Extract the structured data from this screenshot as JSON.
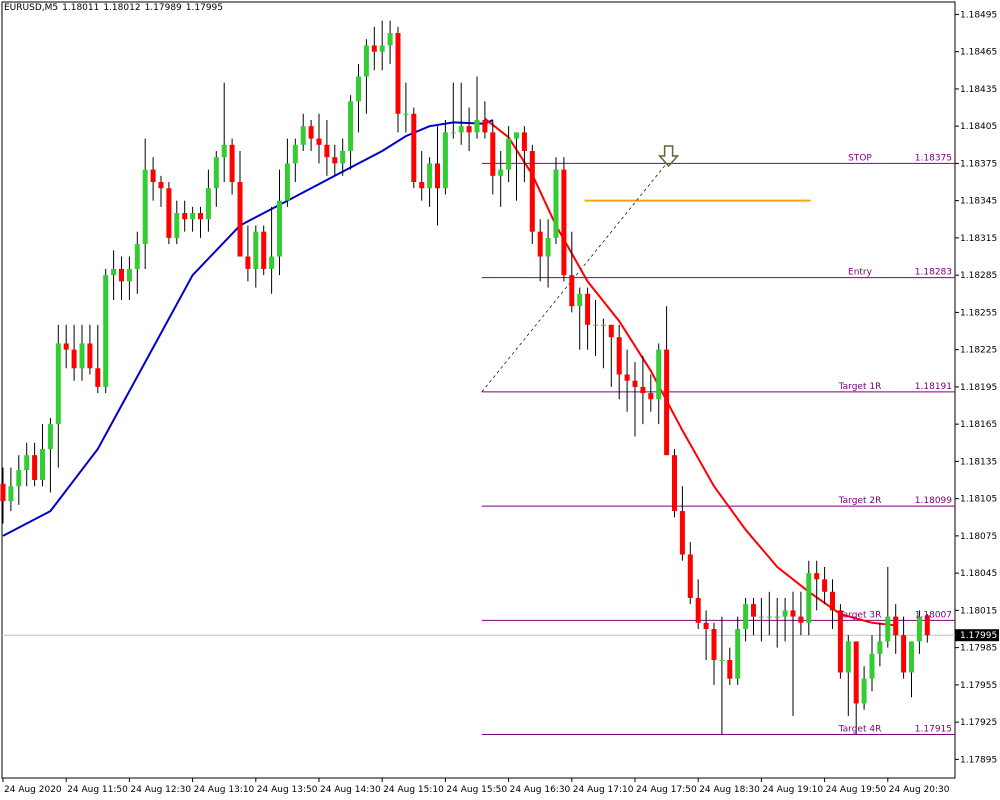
{
  "header": {
    "symbol": "EURUSD,M5",
    "ohlc": [
      "1.18011",
      "1.18012",
      "1.17989",
      "1.17995"
    ]
  },
  "colors": {
    "bull": "#32cd32",
    "bear": "#ff0000",
    "wick": "#000000",
    "ma_fast": "#0000cd",
    "ma_slow": "#ff0000",
    "level_line": "#800080",
    "level_text": "#800080",
    "zone_line": "#ffa500",
    "current_price_line": "#c0c0c0"
  },
  "chart_data": {
    "type": "candlestick",
    "symbol": "EURUSD",
    "timeframe": "M5",
    "ylim": [
      1.1788,
      1.18505
    ],
    "y_ticks": [
      "1.18495",
      "1.18465",
      "1.18435",
      "1.18405",
      "1.18375",
      "1.18345",
      "1.18315",
      "1.18285",
      "1.18255",
      "1.18225",
      "1.18195",
      "1.18165",
      "1.18135",
      "1.18105",
      "1.18075",
      "1.18045",
      "1.18015",
      "1.17985",
      "1.17955",
      "1.17925",
      "1.17895"
    ],
    "x_labels": [
      {
        "i": 0,
        "label": "24 Aug 2020"
      },
      {
        "i": 8,
        "label": "24 Aug 11:50"
      },
      {
        "i": 16,
        "label": "24 Aug 12:30"
      },
      {
        "i": 24,
        "label": "24 Aug 13:10"
      },
      {
        "i": 32,
        "label": "24 Aug 13:50"
      },
      {
        "i": 40,
        "label": "24 Aug 14:30"
      },
      {
        "i": 48,
        "label": "24 Aug 15:10"
      },
      {
        "i": 56,
        "label": "24 Aug 15:50"
      },
      {
        "i": 64,
        "label": "24 Aug 16:30"
      },
      {
        "i": 72,
        "label": "24 Aug 17:10"
      },
      {
        "i": 80,
        "label": "24 Aug 17:50"
      },
      {
        "i": 88,
        "label": "24 Aug 18:30"
      },
      {
        "i": 96,
        "label": "24 Aug 19:10"
      },
      {
        "i": 104,
        "label": "24 Aug 19:50"
      },
      {
        "i": 112,
        "label": "24 Aug 20:30"
      }
    ],
    "candles": [
      [
        1.18117,
        1.1813,
        1.18085,
        1.18103
      ],
      [
        1.18103,
        1.1813,
        1.18095,
        1.18115
      ],
      [
        1.18115,
        1.1814,
        1.181,
        1.18128
      ],
      [
        1.18128,
        1.1815,
        1.18115,
        1.1814
      ],
      [
        1.1814,
        1.1815,
        1.18115,
        1.1812
      ],
      [
        1.1812,
        1.18165,
        1.18115,
        1.18145
      ],
      [
        1.18145,
        1.1817,
        1.1811,
        1.18165
      ],
      [
        1.18165,
        1.18245,
        1.1813,
        1.1823
      ],
      [
        1.1823,
        1.18245,
        1.1821,
        1.18225
      ],
      [
        1.18225,
        1.18245,
        1.182,
        1.1821
      ],
      [
        1.1821,
        1.18245,
        1.182,
        1.1823
      ],
      [
        1.1823,
        1.18245,
        1.18205,
        1.1821
      ],
      [
        1.1821,
        1.18245,
        1.1819,
        1.18195
      ],
      [
        1.18195,
        1.1829,
        1.1819,
        1.18285
      ],
      [
        1.18285,
        1.18305,
        1.18265,
        1.1829
      ],
      [
        1.1829,
        1.183,
        1.18265,
        1.1828
      ],
      [
        1.1828,
        1.183,
        1.18265,
        1.1829
      ],
      [
        1.1829,
        1.1832,
        1.1827,
        1.1831
      ],
      [
        1.1831,
        1.18395,
        1.1829,
        1.1837
      ],
      [
        1.1837,
        1.1838,
        1.18345,
        1.1836
      ],
      [
        1.1836,
        1.18365,
        1.1834,
        1.18355
      ],
      [
        1.18355,
        1.1836,
        1.1831,
        1.18315
      ],
      [
        1.18315,
        1.18345,
        1.1831,
        1.18335
      ],
      [
        1.18335,
        1.18345,
        1.1832,
        1.1833
      ],
      [
        1.1833,
        1.1834,
        1.1832,
        1.18335
      ],
      [
        1.18335,
        1.1834,
        1.18315,
        1.1833
      ],
      [
        1.1833,
        1.1837,
        1.1832,
        1.18355
      ],
      [
        1.18355,
        1.18385,
        1.1834,
        1.1838
      ],
      [
        1.1838,
        1.1844,
        1.1836,
        1.1839
      ],
      [
        1.1839,
        1.18395,
        1.1835,
        1.1836
      ],
      [
        1.1836,
        1.18385,
        1.183,
        1.183
      ],
      [
        1.183,
        1.18325,
        1.1828,
        1.1829
      ],
      [
        1.1829,
        1.18325,
        1.18275,
        1.1832
      ],
      [
        1.1832,
        1.18325,
        1.18285,
        1.1829
      ],
      [
        1.1829,
        1.1834,
        1.1827,
        1.183
      ],
      [
        1.183,
        1.1837,
        1.18285,
        1.18345
      ],
      [
        1.18345,
        1.18395,
        1.1834,
        1.18375
      ],
      [
        1.18375,
        1.18395,
        1.1836,
        1.1839
      ],
      [
        1.1839,
        1.18415,
        1.18385,
        1.18405
      ],
      [
        1.18405,
        1.1841,
        1.18385,
        1.18395
      ],
      [
        1.18395,
        1.18415,
        1.18375,
        1.1839
      ],
      [
        1.1839,
        1.1841,
        1.18365,
        1.1838
      ],
      [
        1.1838,
        1.1839,
        1.18365,
        1.18375
      ],
      [
        1.18375,
        1.18395,
        1.18365,
        1.18385
      ],
      [
        1.18385,
        1.1843,
        1.1837,
        1.18425
      ],
      [
        1.18425,
        1.18455,
        1.184,
        1.18445
      ],
      [
        1.18445,
        1.18475,
        1.18415,
        1.1847
      ],
      [
        1.1847,
        1.18485,
        1.1845,
        1.18465
      ],
      [
        1.18465,
        1.1849,
        1.1845,
        1.1847
      ],
      [
        1.1847,
        1.1849,
        1.18455,
        1.1848
      ],
      [
        1.1848,
        1.18485,
        1.184,
        1.18415
      ],
      [
        1.18415,
        1.1844,
        1.184,
        1.18415
      ],
      [
        1.18415,
        1.1842,
        1.18355,
        1.1836
      ],
      [
        1.1836,
        1.18385,
        1.18345,
        1.18355
      ],
      [
        1.18355,
        1.1838,
        1.1834,
        1.18375
      ],
      [
        1.18375,
        1.18405,
        1.18325,
        1.18355
      ],
      [
        1.18355,
        1.1841,
        1.1835,
        1.184
      ],
      [
        1.184,
        1.1844,
        1.18395,
        1.184
      ],
      [
        1.184,
        1.1844,
        1.1839,
        1.18405
      ],
      [
        1.18405,
        1.1842,
        1.18385,
        1.184
      ],
      [
        1.184,
        1.18445,
        1.18395,
        1.1841
      ],
      [
        1.1841,
        1.18425,
        1.18395,
        1.184
      ],
      [
        1.184,
        1.1841,
        1.1835,
        1.18365
      ],
      [
        1.18365,
        1.18385,
        1.1834,
        1.1837
      ],
      [
        1.1837,
        1.18405,
        1.1836,
        1.18395
      ],
      [
        1.18395,
        1.184,
        1.18345,
        1.184
      ],
      [
        1.184,
        1.18405,
        1.1836,
        1.18385
      ],
      [
        1.18385,
        1.1839,
        1.1831,
        1.1832
      ],
      [
        1.1832,
        1.1833,
        1.1828,
        1.183
      ],
      [
        1.183,
        1.1833,
        1.18275,
        1.18315
      ],
      [
        1.18315,
        1.1838,
        1.1831,
        1.1837
      ],
      [
        1.1837,
        1.1838,
        1.1828,
        1.18285
      ],
      [
        1.18285,
        1.1832,
        1.18255,
        1.1826
      ],
      [
        1.1826,
        1.18275,
        1.18225,
        1.1827
      ],
      [
        1.1827,
        1.18275,
        1.18225,
        1.18245
      ],
      [
        1.18245,
        1.18265,
        1.1822,
        1.18245
      ],
      [
        1.18245,
        1.1825,
        1.1821,
        1.18245
      ],
      [
        1.18245,
        1.18245,
        1.18195,
        1.18235
      ],
      [
        1.18235,
        1.18245,
        1.18185,
        1.18205
      ],
      [
        1.18205,
        1.18225,
        1.18175,
        1.182
      ],
      [
        1.182,
        1.18215,
        1.18155,
        1.18195
      ],
      [
        1.18195,
        1.1822,
        1.18165,
        1.1819
      ],
      [
        1.1819,
        1.18205,
        1.18175,
        1.18185
      ],
      [
        1.18185,
        1.1823,
        1.18165,
        1.18225
      ],
      [
        1.18225,
        1.1826,
        1.1814,
        1.1814
      ],
      [
        1.1814,
        1.18145,
        1.1809,
        1.18095
      ],
      [
        1.18095,
        1.18115,
        1.18055,
        1.1806
      ],
      [
        1.1806,
        1.1807,
        1.1802,
        1.18025
      ],
      [
        1.18025,
        1.1804,
        1.18,
        1.18005
      ],
      [
        1.18005,
        1.18015,
        1.17975,
        1.18
      ],
      [
        1.18,
        1.18005,
        1.17955,
        1.17975
      ],
      [
        1.17975,
        1.1801,
        1.17915,
        1.17975
      ],
      [
        1.17975,
        1.17985,
        1.17955,
        1.1796
      ],
      [
        1.1796,
        1.1801,
        1.17955,
        1.18
      ],
      [
        1.18,
        1.18025,
        1.1799,
        1.1802
      ],
      [
        1.1802,
        1.18025,
        1.17995,
        1.1801
      ],
      [
        1.1801,
        1.18025,
        1.1799,
        1.1801
      ],
      [
        1.1801,
        1.1803,
        1.17995,
        1.1801
      ],
      [
        1.1801,
        1.18025,
        1.17985,
        1.1801
      ],
      [
        1.1801,
        1.18025,
        1.1799,
        1.18015
      ],
      [
        1.18015,
        1.1803,
        1.1793,
        1.1801
      ],
      [
        1.1801,
        1.1803,
        1.17995,
        1.18005
      ],
      [
        1.18005,
        1.18055,
        1.17995,
        1.18045
      ],
      [
        1.18045,
        1.18055,
        1.18015,
        1.1804
      ],
      [
        1.1804,
        1.1805,
        1.1802,
        1.1803
      ],
      [
        1.1803,
        1.1804,
        1.18,
        1.18015
      ],
      [
        1.18015,
        1.1802,
        1.1796,
        1.17965
      ],
      [
        1.17965,
        1.17995,
        1.1793,
        1.1799
      ],
      [
        1.1799,
        1.1799,
        1.17915,
        1.1794
      ],
      [
        1.1794,
        1.1797,
        1.17935,
        1.1796
      ],
      [
        1.1796,
        1.17995,
        1.1795,
        1.1798
      ],
      [
        1.1798,
        1.18005,
        1.1797,
        1.1799
      ],
      [
        1.1799,
        1.1805,
        1.17985,
        1.1801
      ],
      [
        1.1801,
        1.1802,
        1.1798,
        1.17995
      ],
      [
        1.17995,
        1.1801,
        1.1796,
        1.17965
      ],
      [
        1.17965,
        1.1799,
        1.17945,
        1.1799
      ],
      [
        1.1799,
        1.18015,
        1.1798,
        1.1801
      ],
      [
        1.18011,
        1.18012,
        1.17989,
        1.17995
      ]
    ],
    "ma_fast": [
      [
        0,
        1.18075
      ],
      [
        6,
        1.18095
      ],
      [
        12,
        1.18145
      ],
      [
        18,
        1.18215
      ],
      [
        24,
        1.18285
      ],
      [
        30,
        1.18325
      ],
      [
        36,
        1.18345
      ],
      [
        42,
        1.18365
      ],
      [
        48,
        1.18385
      ],
      [
        51,
        1.18397
      ],
      [
        54,
        1.18405
      ],
      [
        57,
        1.18408
      ],
      [
        61,
        1.18407
      ],
      [
        62,
        1.1841
      ]
    ],
    "ma_slow": [
      [
        61,
        1.18411
      ],
      [
        64,
        1.18396
      ],
      [
        67,
        1.18366
      ],
      [
        70,
        1.18325
      ],
      [
        74,
        1.1828
      ],
      [
        78,
        1.18248
      ],
      [
        82,
        1.18208
      ],
      [
        86,
        1.1816
      ],
      [
        90,
        1.18115
      ],
      [
        94,
        1.1808
      ],
      [
        98,
        1.1805
      ],
      [
        102,
        1.1803
      ],
      [
        106,
        1.18012
      ],
      [
        110,
        1.18005
      ],
      [
        113,
        1.18003
      ]
    ],
    "levels": [
      {
        "label": "STOP",
        "price": "1.18375",
        "value": 1.18375,
        "from": 61
      },
      {
        "label": "Entry",
        "price": "1.18283",
        "value": 1.18283,
        "from": 61
      },
      {
        "label": "Target 1R",
        "price": "1.18191",
        "value": 1.18191,
        "from": 61
      },
      {
        "label": "Target 2R",
        "price": "1.18099",
        "value": 1.18099,
        "from": 61
      },
      {
        "label": "Target 3R",
        "price": "1.18007",
        "value": 1.18007,
        "from": 61
      },
      {
        "label": "Target 4R",
        "price": "1.17915",
        "value": 1.17915,
        "from": 61
      }
    ],
    "zone": {
      "value": 1.18345,
      "from": 74,
      "to": 102
    },
    "trendline": {
      "from": [
        61,
        1.18191
      ],
      "to": [
        84,
        1.18375
      ]
    },
    "arrow_at": 84,
    "current_price": {
      "value": 1.17995,
      "label": "1.17995"
    }
  }
}
